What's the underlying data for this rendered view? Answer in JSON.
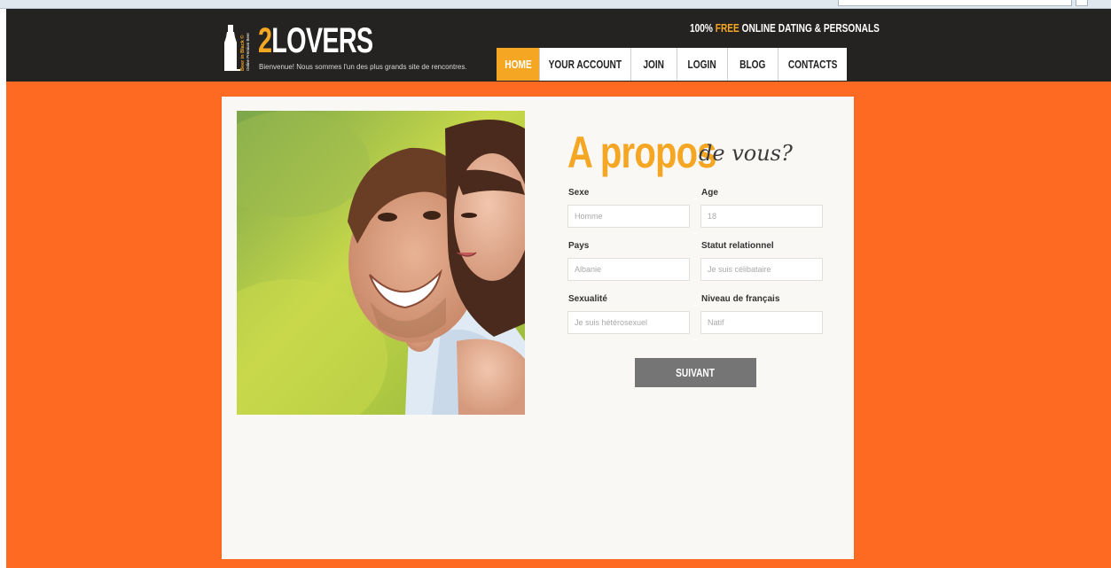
{
  "header": {
    "logo_number": "2",
    "logo_word": "LOVERS",
    "logo_vertical": "Beer in Black ©",
    "logo_vertical_sub": "Online Premium Beer",
    "tagline": "Bienvenue! Nous sommes l'un des plus grands site de rencontres.",
    "slogan_pre": "100% ",
    "slogan_free": "FREE",
    "slogan_post": " ONLINE DATING & PERSONALS"
  },
  "nav": {
    "home": "HOME",
    "account": "YOUR ACCOUNT",
    "join": "JOIN",
    "login": "LOGIN",
    "blog": "BLOG",
    "contacts": "CONTACTS"
  },
  "form": {
    "title_big": "A propos",
    "title_script": "de vous?",
    "fields": [
      {
        "label": "Sexe",
        "placeholder": "Homme"
      },
      {
        "label": "Age",
        "placeholder": "18"
      },
      {
        "label": "Pays",
        "placeholder": "Albanie"
      },
      {
        "label": "Statut relationnel",
        "placeholder": "Je suis célibataire"
      },
      {
        "label": "Sexualité",
        "placeholder": "Je suis hétérosexuel"
      },
      {
        "label": "Niveau de français",
        "placeholder": "Natif"
      }
    ],
    "submit": "SUIVANT"
  },
  "colors": {
    "page_background": "#fe6a22",
    "header": "#252321",
    "accent": "#f5a623",
    "button": "#757575"
  },
  "icons": {
    "logo_mark": "bottle-icon"
  }
}
